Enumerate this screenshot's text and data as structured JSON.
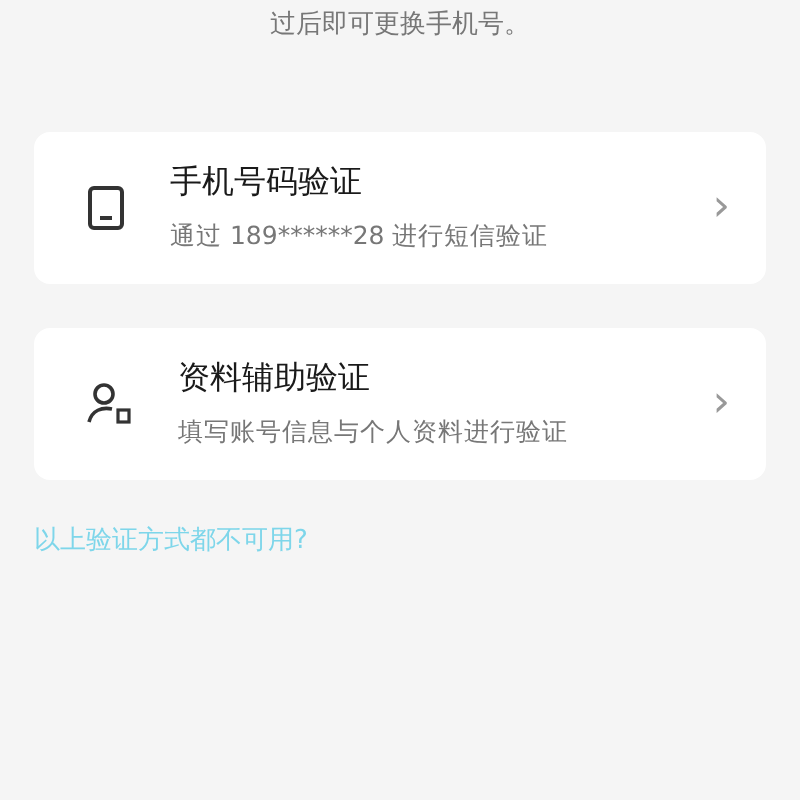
{
  "notice": "过后即可更换手机号。",
  "options": [
    {
      "kind": "phone",
      "title": "手机号码验证",
      "subtitle": "通过 189******28 进行短信验证",
      "chevron": "›"
    },
    {
      "kind": "profile",
      "title": "资料辅助验证",
      "subtitle": "填写账号信息与个人资料进行验证",
      "chevron": "›"
    }
  ],
  "help_link": "以上验证方式都不可用?"
}
